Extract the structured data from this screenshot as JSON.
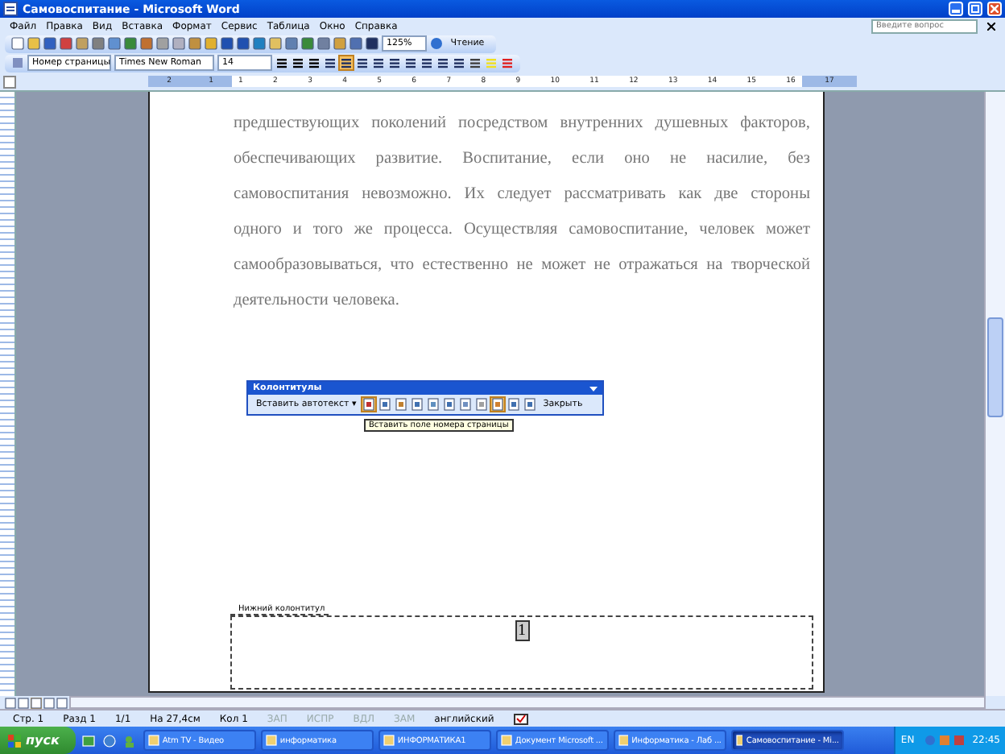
{
  "window": {
    "title": "Самовоспитание - Microsoft Word"
  },
  "menu": [
    "Файл",
    "Правка",
    "Вид",
    "Вставка",
    "Формат",
    "Сервис",
    "Таблица",
    "Окно",
    "Справка"
  ],
  "help_box": {
    "placeholder": "Введите вопрос"
  },
  "standard_toolbar": {
    "zoom": "125%",
    "reading_button": "Чтение"
  },
  "format_toolbar": {
    "style": "Номер страницы",
    "font": "Times New Roman",
    "size": "14"
  },
  "ruler": {
    "left_labels": [
      "2",
      "1"
    ],
    "labels": [
      "1",
      "2",
      "3",
      "4",
      "5",
      "6",
      "7",
      "8",
      "9",
      "10",
      "11",
      "12",
      "13",
      "14",
      "15",
      "16"
    ],
    "right_labels": [
      "17"
    ]
  },
  "document": {
    "lines": [
      "предшествующих поколений посредством внутренних душевных факторов,",
      "обеспечивающих развитие. Воспитание, если оно не насилие, без",
      "самовоспитания невозможно. Их следует рассматривать как две стороны",
      "одного и того же процесса. Осуществляя самовоспитание, человек может",
      "самообразовываться, что естественно не может не отражаться на творческой",
      "деятельности человека."
    ],
    "footer_label": "Нижний колонтитул",
    "page_number": "1"
  },
  "header_footer_toolbar": {
    "title": "Колонтитулы",
    "autotext_button": "Вставить автотекст ▾",
    "close_button": "Закрыть",
    "tooltip": "Вставить поле номера страницы"
  },
  "status_bar": {
    "fields": [
      "Стр. 1",
      "Разд 1",
      "1/1",
      "На 27,4см",
      "Кол 1"
    ],
    "modes": [
      {
        "label": "ЗАП",
        "on": false
      },
      {
        "label": "ИСПР",
        "on": false
      },
      {
        "label": "ВДЛ",
        "on": false
      },
      {
        "label": "ЗАМ",
        "on": false
      }
    ],
    "language": "английский"
  },
  "taskbar": {
    "start": "пуск",
    "tasks": [
      {
        "label": "Atm TV - Видео",
        "selected": false
      },
      {
        "label": "информатика",
        "selected": false
      },
      {
        "label": "ИНФОРМАТИКА1",
        "selected": false
      },
      {
        "label": "Документ Microsoft ...",
        "selected": false
      },
      {
        "label": "Информатика - Лаб ...",
        "selected": false
      },
      {
        "label": "Самовоспитание - Mi...",
        "selected": true
      }
    ],
    "language": "EN",
    "clock": "22:45"
  }
}
